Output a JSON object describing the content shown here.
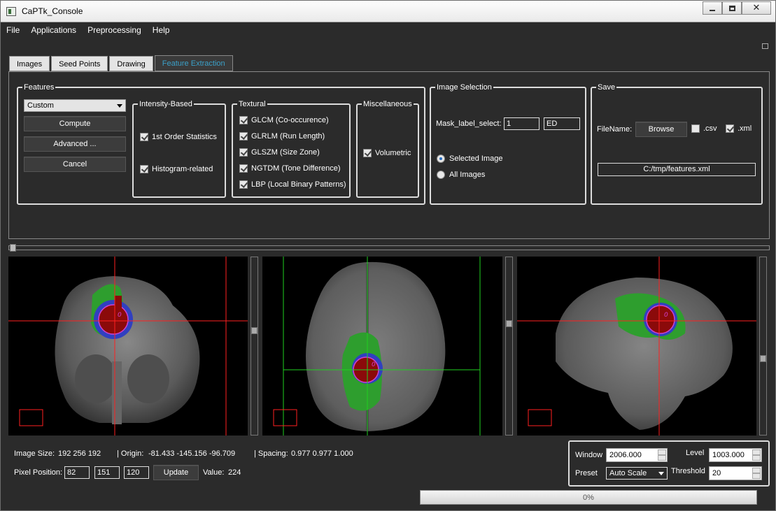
{
  "window": {
    "title": "CaPTk_Console"
  },
  "menu": [
    "File",
    "Applications",
    "Preprocessing",
    "Help"
  ],
  "tabs": [
    "Images",
    "Seed Points",
    "Drawing",
    "Feature Extraction"
  ],
  "features": {
    "title": "Features",
    "preset": "Custom",
    "compute": "Compute",
    "advanced": "Advanced ...",
    "cancel": "Cancel",
    "intensity": {
      "title": "Intensity-Based",
      "items": [
        "1st Order Statistics",
        "Histogram-related"
      ]
    },
    "textural": {
      "title": "Textural",
      "items": [
        "GLCM (Co-occurence)",
        "GLRLM (Run Length)",
        "GLSZM (Size Zone)",
        "NGTDM (Tone Difference)",
        "LBP (Local Binary Patterns)"
      ]
    },
    "misc": {
      "title": "Miscellaneous",
      "items": [
        "Volumetric"
      ]
    }
  },
  "image_selection": {
    "title": "Image Selection",
    "mask_label": "Mask_label_select:",
    "mask_value": "1",
    "mask_name": "ED",
    "selected": "Selected Image",
    "all": "All Images"
  },
  "save": {
    "title": "Save",
    "filename_label": "FileName:",
    "browse": "Browse",
    "csv": ".csv",
    "xml": ".xml",
    "path": "C:/tmp/features.xml",
    "csv_checked": false,
    "xml_checked": true
  },
  "status": {
    "image_size_label": "Image Size:",
    "image_size": "192  256  192",
    "origin_label": "| Origin:",
    "origin": "-81.433  -145.156  -96.709",
    "spacing_label": "| Spacing:",
    "spacing": "0.977  0.977  1.000",
    "pixel_label": "Pixel Position:",
    "px": "82",
    "py": "151",
    "pz": "120",
    "update": "Update",
    "value_label": "Value:",
    "value": "224"
  },
  "wl": {
    "window_label": "Window",
    "window": "2006.000",
    "level_label": "Level",
    "level": "1003.000",
    "preset_label": "Preset",
    "preset": "Auto Scale",
    "threshold_label": "Threshold",
    "threshold": "20"
  },
  "progress": "0%",
  "colors": {
    "tab_active": "#3aa0c8",
    "crosshair_red": "#ff2020",
    "crosshair_green": "#20d020",
    "edema": "#2e9e2e",
    "core": "#8b0a0a"
  }
}
